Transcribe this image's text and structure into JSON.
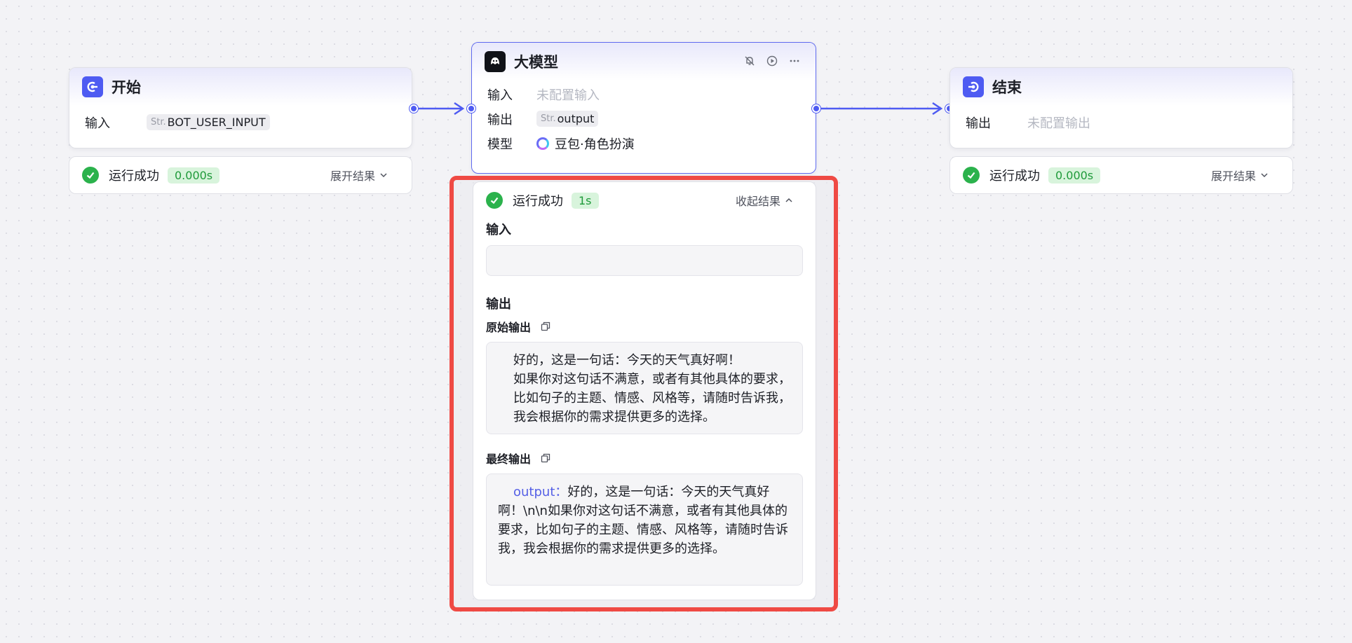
{
  "start_node": {
    "title": "开始",
    "input_label": "输入",
    "input_type": "Str.",
    "input_value": "BOT_USER_INPUT",
    "status": "运行成功",
    "time": "0.000s",
    "toggle": "展开结果"
  },
  "llm_node": {
    "title": "大模型",
    "input_label": "输入",
    "input_value": "未配置输入",
    "output_label": "输出",
    "output_type": "Str.",
    "output_value": "output",
    "model_label": "模型",
    "model_value": "豆包·角色扮演",
    "status": "运行成功",
    "time": "1s",
    "toggle": "收起结果",
    "result": {
      "input_title": "输入",
      "output_title": "输出",
      "raw_output_title": "原始输出",
      "raw_output_text": "好的，这是一句话：今天的天气真好啊！\n如果你对这句话不满意，或者有其他具体的要求，比如句子的主题、情感、风格等，请随时告诉我，我会根据你的需求提供更多的选择。",
      "final_output_title": "最终输出",
      "final_output_key": "output：",
      "final_output_text": "好的，这是一句话：今天的天气真好啊！\\n\\n如果你对这句话不满意，或者有其他具体的要求，比如句子的主题、情感、风格等，请随时告诉我，我会根据你的需求提供更多的选择。"
    }
  },
  "end_node": {
    "title": "结束",
    "output_label": "输出",
    "output_value": "未配置输出",
    "status": "运行成功",
    "time": "0.000s",
    "toggle": "展开结果"
  },
  "colors": {
    "accent": "#4e5bf2",
    "success": "#2bb24c",
    "highlight": "#ef4a44"
  }
}
